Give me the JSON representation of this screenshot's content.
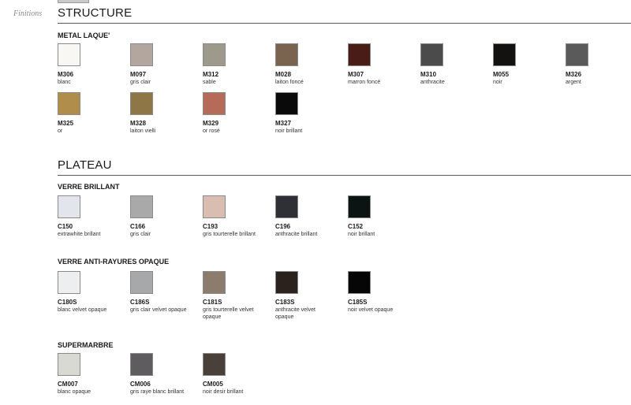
{
  "side_label": "Finitions",
  "sections": [
    {
      "title": "STRUCTURE",
      "groups": [
        {
          "label": "METAL LAQUE'",
          "items": [
            {
              "code": "M306",
              "name": "blanc",
              "color": "#f8f7f3"
            },
            {
              "code": "M097",
              "name": "gris clair",
              "color": "#b3a69e"
            },
            {
              "code": "M312",
              "name": "sable",
              "color": "#9e9a8b"
            },
            {
              "code": "M028",
              "name": "laiton foncé",
              "color": "#7a6450"
            },
            {
              "code": "M307",
              "name": "marron foncé",
              "color": "#4a1c18"
            },
            {
              "code": "M310",
              "name": "anthracite",
              "color": "#4b4b4b"
            },
            {
              "code": "M055",
              "name": "noir",
              "color": "#141111"
            },
            {
              "code": "M326",
              "name": "argent",
              "color": "#5a5a5a"
            },
            {
              "code": "M325",
              "name": "or",
              "color": "#b08d4a"
            },
            {
              "code": "M328",
              "name": "laiton vielli",
              "color": "#8e7646"
            },
            {
              "code": "M329",
              "name": "or rosé",
              "color": "#b56b57"
            },
            {
              "code": "M327",
              "name": "noir brillant",
              "color": "#0a0a0a"
            }
          ]
        }
      ]
    },
    {
      "title": "PLATEAU",
      "groups": [
        {
          "label": "VERRE BRILLANT",
          "items": [
            {
              "code": "C150",
              "name": "extrawhite brillant",
              "color": "#e2e6ec"
            },
            {
              "code": "C166",
              "name": "gris clair",
              "color": "#a9a9a9"
            },
            {
              "code": "C193",
              "name": "gris tourterelle brillant",
              "color": "#d8bdb0"
            },
            {
              "code": "C196",
              "name": "anthracite brillant",
              "color": "#2e3036"
            },
            {
              "code": "C152",
              "name": "noir brillant",
              "color": "#0b1412"
            }
          ]
        },
        {
          "label": "VERRE ANTI-RAYURES OPAQUE",
          "items": [
            {
              "code": "C180S",
              "name": "blanc velvet opaque",
              "color": "#eceef0"
            },
            {
              "code": "C186S",
              "name": "gris clair velvet opaque",
              "color": "#a7a8aa"
            },
            {
              "code": "C181S",
              "name": "gris tourterelle velvet opaque",
              "color": "#8b7c6e"
            },
            {
              "code": "C183S",
              "name": "anthracite velvet opaque",
              "color": "#2b221e"
            },
            {
              "code": "C185S",
              "name": "noir velvet opaque",
              "color": "#060606"
            }
          ]
        },
        {
          "label": "SUPERMARBRE",
          "items": [
            {
              "code": "CM007",
              "name": "blanc opaque",
              "color": "#d7d9d2"
            },
            {
              "code": "CM006",
              "name": "gris raye blanc brillant",
              "color": "#5e5c5e"
            },
            {
              "code": "CM005",
              "name": "noir desir brillant",
              "color": "#4a403a"
            }
          ]
        }
      ]
    }
  ]
}
